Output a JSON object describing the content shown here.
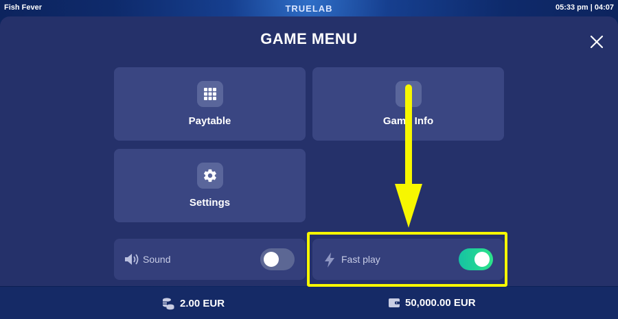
{
  "topbar": {
    "game_title": "Fish Fever",
    "brand": "TRUELAB",
    "clock": "05:33 pm | 04:07"
  },
  "menu": {
    "title": "GAME MENU",
    "tiles": [
      {
        "label": "Paytable",
        "icon": "grid-icon"
      },
      {
        "label": "Game Info",
        "icon": "info-icon"
      },
      {
        "label": "Settings",
        "icon": "gear-icon"
      }
    ],
    "toggles": [
      {
        "label": "Sound",
        "icon": "speaker-icon",
        "state": "off"
      },
      {
        "label": "Fast play",
        "icon": "lightning-icon",
        "state": "on"
      }
    ]
  },
  "bottombar": {
    "bet": "2.00 EUR",
    "balance": "50,000.00 EUR"
  },
  "colors": {
    "panel": "#25316a",
    "tile": "#3a4682",
    "highlight": "#f7f700",
    "toggle_on": "#2ce38a"
  }
}
